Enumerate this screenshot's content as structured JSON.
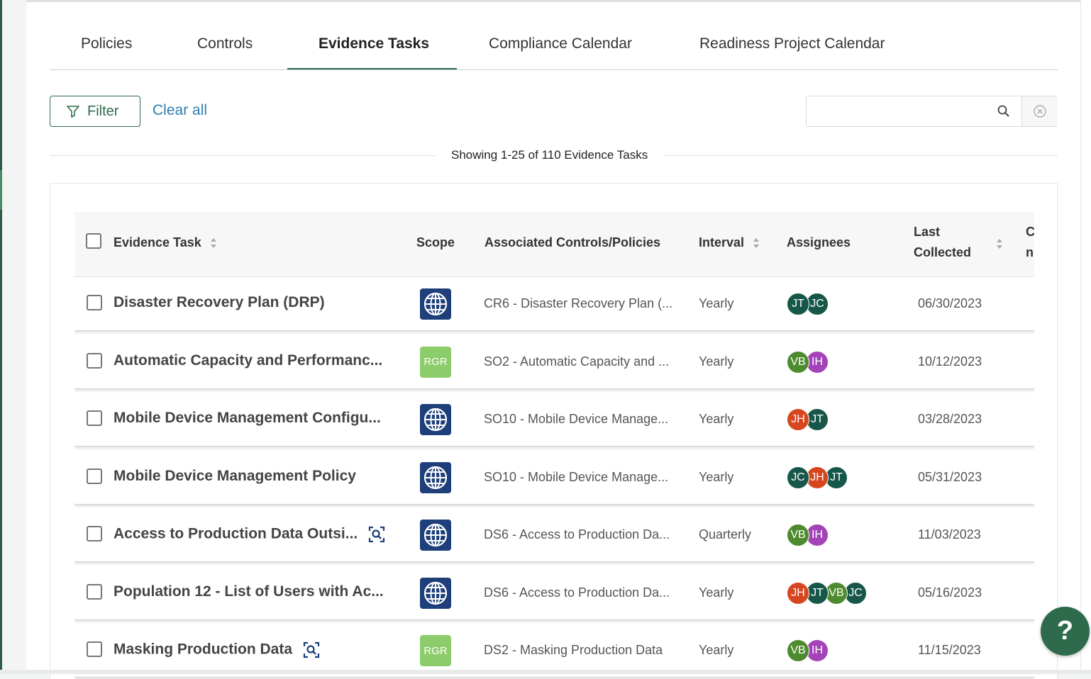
{
  "tabs": [
    {
      "label": "Policies"
    },
    {
      "label": "Controls"
    },
    {
      "label": "Evidence Tasks"
    },
    {
      "label": "Compliance Calendar"
    },
    {
      "label": "Readiness Project Calendar"
    }
  ],
  "active_tab": "Evidence Tasks",
  "toolbar": {
    "filter_label": "Filter",
    "clear_all_label": "Clear all",
    "search_value": ""
  },
  "summary": "Showing 1-25 of 110 Evidence Tasks",
  "columns": {
    "task": "Evidence Task",
    "scope": "Scope",
    "controls": "Associated Controls/Policies",
    "interval": "Interval",
    "assignees": "Assignees",
    "last_collected_1": "Last",
    "last_collected_2": "Collected",
    "next_partial_1": "C",
    "next_partial_2": "n"
  },
  "colors": {
    "brand": "#2e6b4d",
    "link": "#2f7fb0",
    "scope_globe": "#1e3f7a",
    "scope_rgr": "#8ccc6a"
  },
  "rows": [
    {
      "task": "Disaster Recovery Plan (DRP)",
      "scope": "globe-icon",
      "controls": "CR6 - Disaster Recovery Plan (...",
      "interval": "Yearly",
      "assignees": [
        "JT",
        "JC"
      ],
      "last_collected": "06/30/2023",
      "has_evidence_icon": false
    },
    {
      "task": "Automatic Capacity and Performanc...",
      "scope": "RGR",
      "controls": "SO2 - Automatic Capacity and ...",
      "interval": "Yearly",
      "assignees": [
        "VB",
        "IH"
      ],
      "last_collected": "10/12/2023",
      "has_evidence_icon": false
    },
    {
      "task": "Mobile Device Management Configu...",
      "scope": "globe-icon",
      "controls": "SO10 - Mobile Device Manage...",
      "interval": "Yearly",
      "assignees": [
        "JH",
        "JT"
      ],
      "last_collected": "03/28/2023",
      "has_evidence_icon": false
    },
    {
      "task": "Mobile Device Management Policy",
      "scope": "globe-icon",
      "controls": "SO10 - Mobile Device Manage...",
      "interval": "Yearly",
      "assignees": [
        "JC",
        "JH",
        "JT"
      ],
      "last_collected": "05/31/2023",
      "has_evidence_icon": false
    },
    {
      "task": "Access to Production Data Outsi...",
      "scope": "globe-icon",
      "controls": "DS6 - Access to Production Da...",
      "interval": "Quarterly",
      "assignees": [
        "VB",
        "IH"
      ],
      "last_collected": "11/03/2023",
      "has_evidence_icon": true
    },
    {
      "task": "Population 12 - List of Users with Ac...",
      "scope": "globe-icon",
      "controls": "DS6 - Access to Production Da...",
      "interval": "Yearly",
      "assignees": [
        "JH",
        "JT",
        "VB",
        "JC"
      ],
      "last_collected": "05/16/2023",
      "has_evidence_icon": false
    },
    {
      "task": "Masking Production Data",
      "scope": "RGR",
      "controls": "DS2 - Masking Production Data",
      "interval": "Yearly",
      "assignees": [
        "VB",
        "IH"
      ],
      "last_collected": "11/15/2023",
      "has_evidence_icon": true
    }
  ],
  "avatar_colors": {
    "JT": "#17574a",
    "JC": "#17574a",
    "VB": "#4e8a2e",
    "IH": "#a343b8",
    "JH": "#d6461f"
  },
  "help": {
    "label": "?"
  }
}
